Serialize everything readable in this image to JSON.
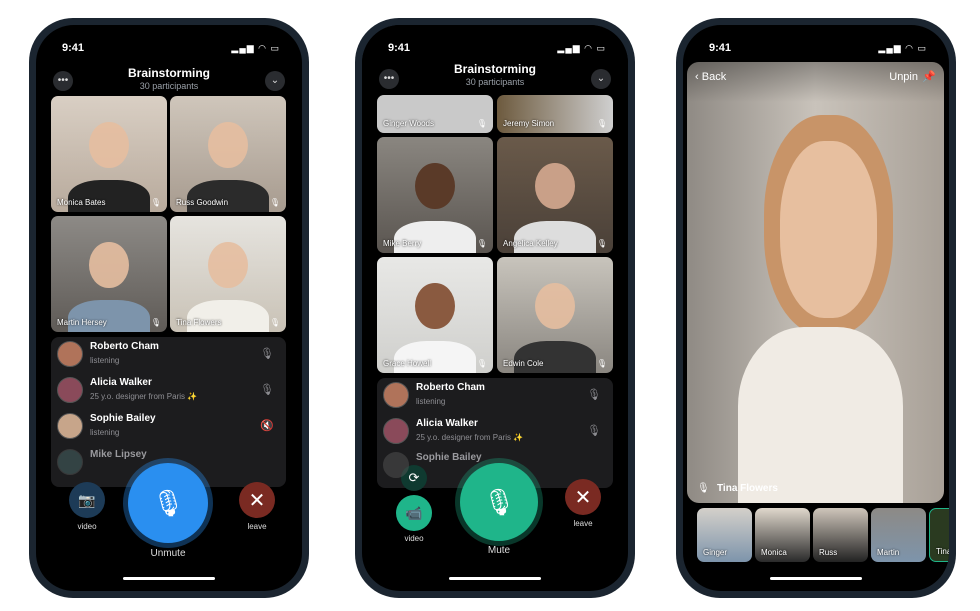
{
  "status_time": "9:41",
  "call": {
    "title": "Brainstorming",
    "subtitle": "30 participants"
  },
  "phone1": {
    "tiles": [
      {
        "name": "Monica Bates"
      },
      {
        "name": "Russ Goodwin"
      },
      {
        "name": "Martin Hersey"
      },
      {
        "name": "Tina Flowers"
      }
    ],
    "participants": [
      {
        "name": "Roberto Cham",
        "status": "listening",
        "mic": "mic-icon"
      },
      {
        "name": "Alicia Walker",
        "status": "25 y.o. designer from Paris ✨",
        "mic": "mic-icon"
      },
      {
        "name": "Sophie Bailey",
        "status": "listening",
        "mic": "mic-muted-icon"
      },
      {
        "name": "Mike Lipsey",
        "status": ""
      }
    ],
    "video_label": "video",
    "main_label": "Unmute",
    "leave_label": "leave",
    "accent": "#2a8ff0"
  },
  "phone2": {
    "tiles": [
      {
        "name": "Ginger Woods"
      },
      {
        "name": "Jeremy Simon"
      },
      {
        "name": "Mike Berry"
      },
      {
        "name": "Angelica Kelley"
      },
      {
        "name": "Grace Howell"
      },
      {
        "name": "Edwin Cole"
      }
    ],
    "participants": [
      {
        "name": "Roberto Cham",
        "status": "listening"
      },
      {
        "name": "Alicia Walker",
        "status": "25 y.o. designer from Paris ✨"
      },
      {
        "name": "Sophie Bailey",
        "status": ""
      }
    ],
    "video_label": "video",
    "main_label": "Mute",
    "leave_label": "leave",
    "accent": "#1fb58a"
  },
  "phone3": {
    "back_label": "Back",
    "unpin_label": "Unpin",
    "speaker": "Tina Flowers",
    "thumbs": [
      {
        "name": "Ginger"
      },
      {
        "name": "Monica"
      },
      {
        "name": "Russ"
      },
      {
        "name": "Martin"
      },
      {
        "name": "Tina"
      }
    ]
  },
  "leave_color": "#7a2a22"
}
